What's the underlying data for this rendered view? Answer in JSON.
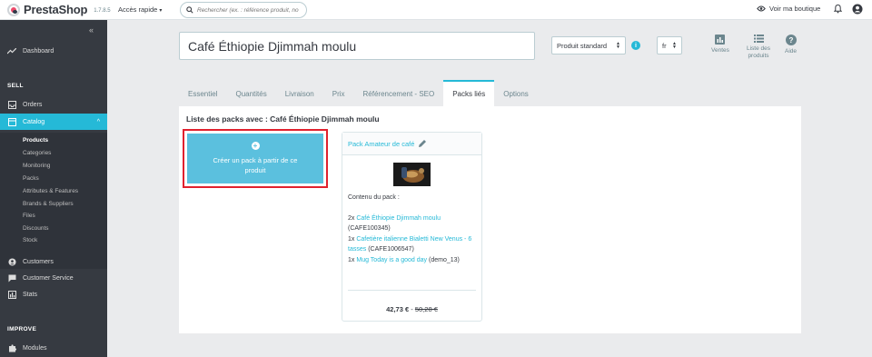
{
  "header": {
    "logo_text": "PrestaShop",
    "version": "1.7.8.5",
    "quick_access": "Accès rapide",
    "search_placeholder": "Rechercher (ex. : référence produit, no",
    "view_shop": "Voir ma boutique"
  },
  "sidebar": {
    "dashboard": "Dashboard",
    "sell_heading": "SELL",
    "orders": "Orders",
    "catalog": "Catalog",
    "catalog_sub": [
      "Products",
      "Categories",
      "Monitoring",
      "Packs",
      "Attributes & Features",
      "Brands & Suppliers",
      "Files",
      "Discounts",
      "Stock"
    ],
    "customers": "Customers",
    "customer_service": "Customer Service",
    "stats": "Stats",
    "improve_heading": "IMPROVE",
    "modules": "Modules"
  },
  "product": {
    "name": "Café Éthiopie Djimmah moulu",
    "type": "Produit standard",
    "lang": "fr"
  },
  "toolbar": {
    "sales": "Ventes",
    "product_list": "Liste des produits",
    "help": "Aide"
  },
  "tabs": [
    "Essentiel",
    "Quantités",
    "Livraison",
    "Prix",
    "Référencement - SEO",
    "Packs liés",
    "Options"
  ],
  "packs": {
    "title": "Liste des packs avec : Café Éthiopie Djimmah moulu",
    "create_label": "Créer un pack à partir de ce produit",
    "card": {
      "name": "Pack Amateur de café",
      "contents_label": "Contenu du pack :",
      "item1_qty": "2x",
      "item1_name": "Café Éthiopie Djimmah moulu",
      "item1_ref": "(CAFE100345)",
      "item2_qty": "1x",
      "item2_name": "Cafetière italienne Bialetti New Venus - 6 tasses",
      "item2_ref": "(CAFE1006547)",
      "item3_qty": "1x",
      "item3_name": "Mug Today is a good day",
      "item3_ref": "(demo_13)",
      "price": "42,73 €",
      "old_price": "50,28 €"
    }
  },
  "colors": {
    "accent": "#25b9d7",
    "sidebar_bg": "#363a41",
    "highlight_border": "#e0212e",
    "create_button": "#5bc0de"
  }
}
